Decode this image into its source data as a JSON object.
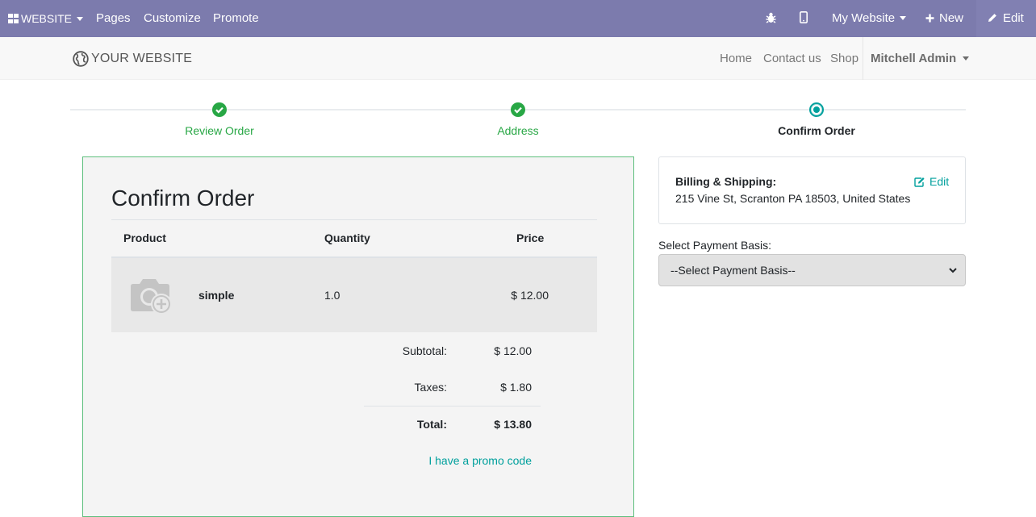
{
  "admin_bar": {
    "website_menu": "WEBSITE",
    "pages": "Pages",
    "customize": "Customize",
    "promote": "Promote",
    "my_website": "My Website",
    "new": "New",
    "edit": "Edit",
    "bg_color": "#7c7bad"
  },
  "header": {
    "logo_text": "YOUR WEBSITE",
    "nav": [
      "Home",
      "Contact us",
      "Shop"
    ],
    "user": "Mitchell Admin"
  },
  "wizard": {
    "steps": [
      {
        "label": "Review Order",
        "state": "done"
      },
      {
        "label": "Address",
        "state": "done"
      },
      {
        "label": "Confirm Order",
        "state": "current"
      }
    ]
  },
  "order": {
    "title": "Confirm Order",
    "columns": [
      "Product",
      "Quantity",
      "Price"
    ],
    "rows": [
      {
        "product": "simple",
        "quantity": "1.0",
        "price": "$ 12.00",
        "image_icon": "camera-plus-icon"
      }
    ],
    "subtotal_label": "Subtotal:",
    "subtotal": "$ 12.00",
    "taxes_label": "Taxes:",
    "taxes": "$ 1.80",
    "total_label": "Total:",
    "total": "$ 13.80",
    "promo_link": "I have a promo code"
  },
  "billing": {
    "title": "Billing & Shipping:",
    "address": "215 Vine St, Scranton PA 18503, United States",
    "edit": "Edit"
  },
  "payment": {
    "label": "Select Payment Basis:",
    "selected": "--Select Payment Basis--"
  },
  "colors": {
    "accent": "#00a09d",
    "success": "#28a745",
    "card_border": "#5dbf7d"
  }
}
